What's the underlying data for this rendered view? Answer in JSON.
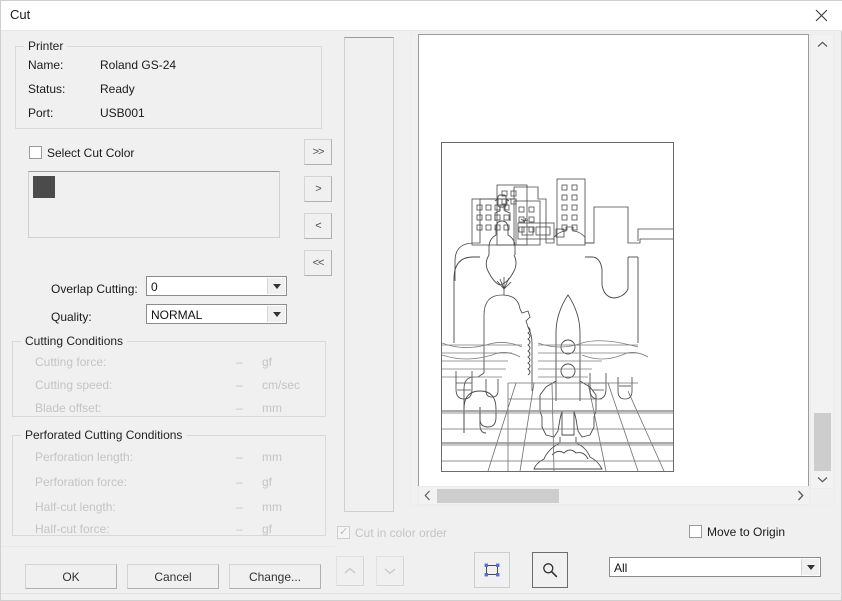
{
  "window": {
    "title": "Cut",
    "close_icon": "close-icon"
  },
  "printer": {
    "group_label": "Printer",
    "fields": [
      {
        "label": "Name:",
        "value": "Roland GS-24"
      },
      {
        "label": "Status:",
        "value": "Ready"
      },
      {
        "label": "Port:",
        "value": "USB001"
      }
    ]
  },
  "cut_color": {
    "checkbox_label": "Select Cut Color",
    "checked": false,
    "swatch_color": "#4b4b4b"
  },
  "transfer_buttons": [
    {
      "label": ">>",
      "name": "move-all-right-button"
    },
    {
      "label": ">",
      "name": "move-right-button"
    },
    {
      "label": "<",
      "name": "move-left-button"
    },
    {
      "label": "<<",
      "name": "move-all-left-button"
    }
  ],
  "overlap": {
    "label": "Overlap Cutting:",
    "value": "0"
  },
  "quality": {
    "label": "Quality:",
    "value": "NORMAL"
  },
  "cutting_conditions": {
    "group_label": "Cutting Conditions",
    "rows": [
      {
        "label": "Cutting force:",
        "value": "–",
        "unit": "gf"
      },
      {
        "label": "Cutting speed:",
        "value": "–",
        "unit": "cm/sec"
      },
      {
        "label": "Blade offset:",
        "value": "–",
        "unit": "mm"
      }
    ]
  },
  "perforated_conditions": {
    "group_label": "Perforated Cutting Conditions",
    "rows": [
      {
        "label": "Perforation length:",
        "value": "–",
        "unit": "mm"
      },
      {
        "label": "Perforation  force:",
        "value": "–",
        "unit": "gf"
      },
      {
        "label": "Half-cut length:",
        "value": "–",
        "unit": "mm"
      },
      {
        "label": "Half-cut force:",
        "value": "–",
        "unit": "gf"
      }
    ]
  },
  "dialog_buttons": {
    "ok": "OK",
    "cancel": "Cancel",
    "change": "Change..."
  },
  "order_controls": {
    "cut_in_color_order_label": "Cut in color order",
    "cut_in_color_order_checked": true,
    "cut_in_color_order_disabled": true,
    "move_up_icon": "chevron-up-icon",
    "move_down_icon": "chevron-down-icon"
  },
  "view_controls": {
    "fit_icon": "fit-to-selection-icon",
    "zoom_icon": "magnifier-icon"
  },
  "origin": {
    "label": "Move to Origin",
    "checked": false
  },
  "scope": {
    "value": "All"
  },
  "scrollbars": {
    "vertical": {
      "up_icon": "chevron-up-icon",
      "down_icon": "chevron-down-icon",
      "thumb_top_pct": 82,
      "thumb_height_pct": 13
    },
    "horizontal": {
      "left_icon": "chevron-left-icon",
      "right_icon": "chevron-right-icon",
      "thumb_left_pct": 4,
      "thumb_width_pct": 32
    }
  },
  "preview": {
    "artwork_name": "space-shuttle-launch-cut-outline"
  }
}
